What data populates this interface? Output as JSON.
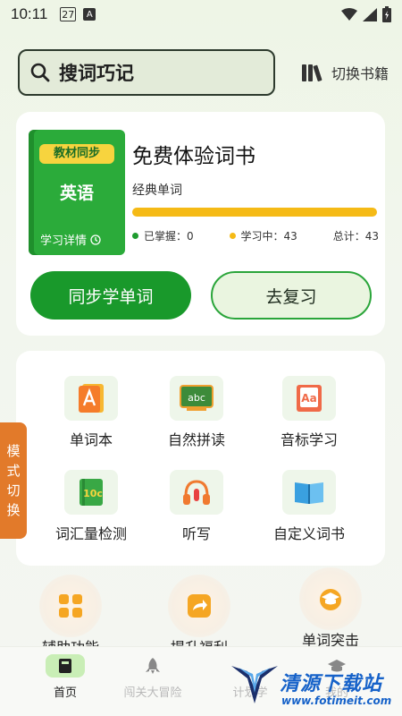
{
  "status_bar": {
    "time": "10:11",
    "calendar_day": "27",
    "app_badge": "A"
  },
  "search": {
    "label": "搜词巧记"
  },
  "switch_book_label": "切换书籍",
  "current_book": {
    "tag": "教材同步",
    "subject": "英语",
    "detail_label": "学习详情",
    "title": "免费体验词书",
    "subtitle": "经典单词",
    "progress_fraction": 0,
    "stats": {
      "mastered_label": "已掌握：0",
      "learning_label": "学习中：43",
      "total_label": "总计：43"
    },
    "colors": {
      "mastered": "#1f9c2f",
      "learning": "#f5ba16"
    }
  },
  "actions": {
    "learn_label": "同步学单词",
    "review_label": "去复习"
  },
  "features": [
    {
      "label": "单词本",
      "icon": "notebook-icon"
    },
    {
      "label": "自然拼读",
      "icon": "abc-board-icon"
    },
    {
      "label": "音标学习",
      "icon": "phonetic-icon"
    },
    {
      "label": "词汇量检测",
      "icon": "test-book-icon"
    },
    {
      "label": "听写",
      "icon": "headphones-icon"
    },
    {
      "label": "自定义词书",
      "icon": "open-book-icon"
    }
  ],
  "mode_switch_label": "模式切换",
  "extras": [
    {
      "label": "辅助功能",
      "icon": "grid-apps-icon"
    },
    {
      "label": "提升福利",
      "icon": "share-box-icon"
    },
    {
      "label": "单词突击",
      "icon": "graduation-cap-icon"
    }
  ],
  "tabs": [
    {
      "label": "首页",
      "icon": "book-icon",
      "active": true
    },
    {
      "label": "闯关大冒险",
      "icon": "rocket-icon",
      "active": false
    },
    {
      "label": "计划学",
      "icon": "plan-icon",
      "active": false
    },
    {
      "label": "我的",
      "icon": "cap-icon",
      "active": false
    }
  ],
  "watermark": {
    "title": "清源下载站",
    "url": "www.fotimeit.com"
  },
  "colors": {
    "accent": "#19992b",
    "yellow": "#f5ba16",
    "orange": "#e27a2a"
  }
}
